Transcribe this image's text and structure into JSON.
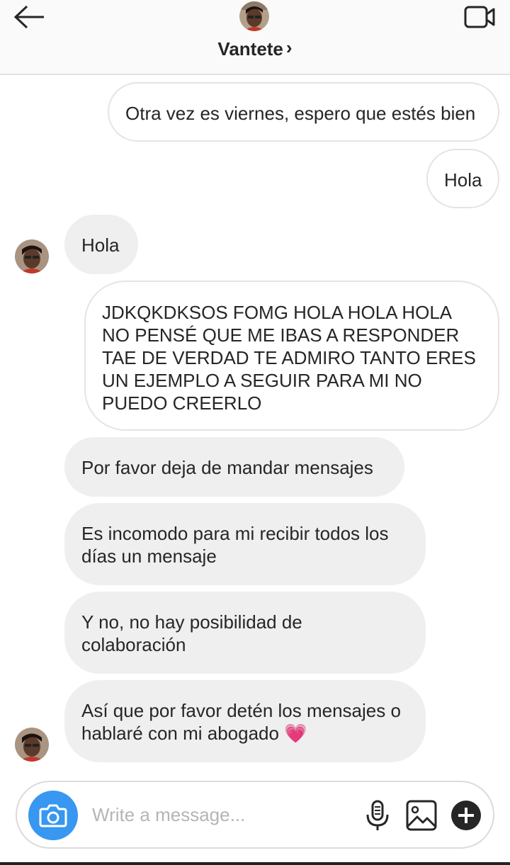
{
  "header": {
    "contact_name": "Vantete",
    "chevron_glyph": "›",
    "back_icon": "arrow-left-icon",
    "video_icon": "video-camera-icon"
  },
  "messages": [
    {
      "side": "sent",
      "text": "Otra vez es viernes, espero que estés bien"
    },
    {
      "side": "sent",
      "text": "Hola"
    },
    {
      "side": "received",
      "text": "Hola"
    },
    {
      "side": "sent",
      "text": "JDKQKDKSOS FOMG HOLA HOLA HOLA NO PENSÉ QUE ME IBAS A RESPONDER TAE DE VERDAD TE ADMIRO TANTO ERES UN EJEMPLO A SEGUIR PARA MI NO PUEDO CREERLO"
    },
    {
      "side": "received",
      "text": "Por favor deja de mandar mensajes"
    },
    {
      "side": "received",
      "text": "Es incomodo para mi recibir todos los días un mensaje"
    },
    {
      "side": "received",
      "text": "Y no, no hay posibilidad de colaboración"
    },
    {
      "side": "received",
      "text": "Así que por favor detén los mensajes o hablaré con mi abogado",
      "emoji": "💗"
    }
  ],
  "composer": {
    "placeholder": "Write a message...",
    "value": "",
    "icons": [
      "camera-icon",
      "microphone-icon",
      "gallery-icon",
      "plus-icon"
    ]
  },
  "colors": {
    "accent": "#3897f0",
    "received_bubble": "#efefef",
    "sent_border": "#e4e4e4",
    "header_bg": "#fafafa",
    "placeholder": "#b5b5b5"
  }
}
